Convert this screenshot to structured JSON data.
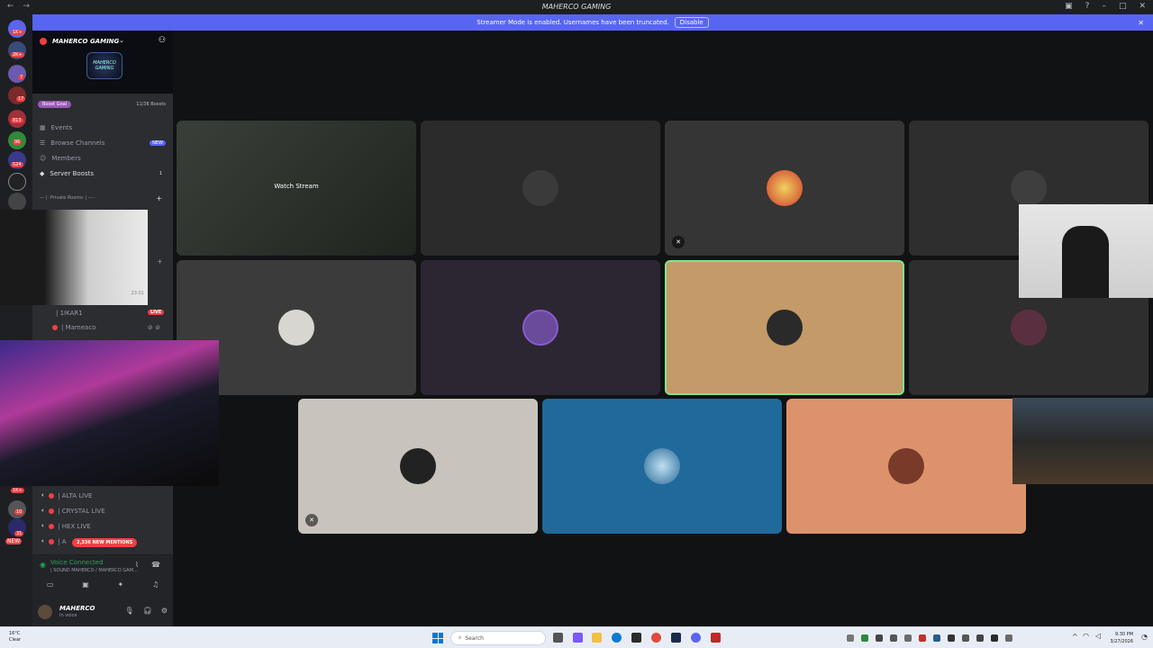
{
  "window": {
    "title": "MAHERCO GAMING",
    "nav_back": "←",
    "nav_fwd": "→"
  },
  "banner": {
    "text": "Streamer Mode is enabled. Usernames have been truncated.",
    "button": "Disable"
  },
  "rail": {
    "badges": [
      "1K+",
      "2K+",
      "7",
      "17",
      "813",
      "96",
      "524",
      "1K+",
      "10",
      "31",
      "NEW"
    ]
  },
  "guild": {
    "name": "MAHERCO GAMING",
    "logo_text": "MAHERCO GAMING",
    "boost_goal_label": "Boost Goal",
    "boost_count": "11/36 Boosts"
  },
  "channels": [
    {
      "label": "Events",
      "icon": "calendar-icon"
    },
    {
      "label": "Browse Channels",
      "icon": "browse-icon",
      "tag": "NEW"
    },
    {
      "label": "Members",
      "icon": "members-icon"
    },
    {
      "label": "Server Boosts",
      "icon": "boost-icon",
      "count": "1"
    }
  ],
  "category": "--- | ·Private Rooms· | --- ·",
  "voice_users_top": [
    {
      "name": "| 1IKAR1",
      "live": "LIVE"
    },
    {
      "name": "| Mameaco"
    }
  ],
  "voice_users_bottom": [
    {
      "name": "| ALTA LIVE"
    },
    {
      "name": "| CRYSTAL LIVE"
    },
    {
      "name": "| HEX LIVE"
    },
    {
      "name": "| A"
    }
  ],
  "mentions": "2,336 NEW MENTIONS",
  "voice_panel": {
    "status": "Voice Connected",
    "channel": "| SOUND MAHERCO / MAHERCO GAM..."
  },
  "user": {
    "name": "MAHERCO",
    "status": "In voice"
  },
  "stage": {
    "watch_stream": "Watch Stream",
    "cam_timestamp": "23:01"
  },
  "taskbar": {
    "temp": "16°C",
    "weather": "Clear",
    "search": "Search",
    "time": "9:30 PM",
    "date": "3/27/2026"
  },
  "colors": {
    "accent": "#5865f2",
    "live": "#f23f43",
    "connected": "#23a55a",
    "speaking_ring": "#7ee787"
  }
}
